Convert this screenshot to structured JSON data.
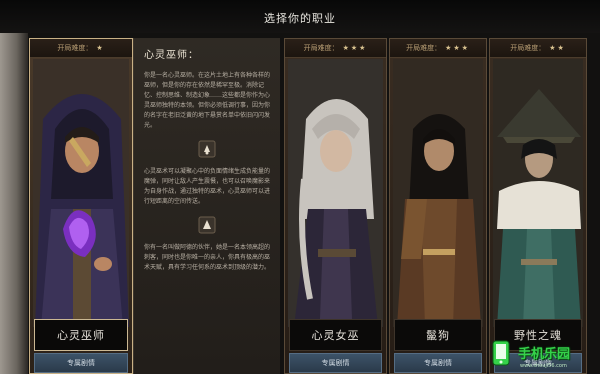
{
  "screen_title": "选择你的职业",
  "cards": [
    {
      "difficulty_label": "开局难度：",
      "stars": "★",
      "name": "心灵巫师",
      "story_button": "专属剧情"
    },
    {
      "difficulty_label": "开局难度：",
      "stars": "★★★",
      "name": "心灵女巫",
      "story_button": "专属剧情"
    },
    {
      "difficulty_label": "开局难度：",
      "stars": "★★★",
      "name": "鬣狗",
      "story_button": "专属剧情"
    },
    {
      "difficulty_label": "开局难度：",
      "stars": "★★",
      "name": "野性之魂",
      "story_button": "专属剧情"
    }
  ],
  "detail": {
    "title": "心灵巫师：",
    "paragraph1": "你是一名心灵巫师。在这片土地上有各种各样的巫师，但是你的存在依然是稀罕至极。消除记忆、控制思维、制造幻象……这些都是你作为心灵巫师独特的本领。但你必须低调行事，因为你的名字在老旧泛黄的地下悬赏名单中依旧闪闪发光。",
    "paragraph2": "心灵巫术可以凝聚心中的负面情绪生成负能量的魔弹，同时让敌人产生震慑，也可以召唤魔影来为自身作战，通过独特的巫术，心灵巫师可以进行短距离的空间传送。",
    "paragraph3": "你有一名叫做阿德的伙伴，她是一名本领高超的刺客，同时也是你唯一的亲人，你具有极高的巫术天赋，具有学习任何系的巫术到顶级的潜力。"
  },
  "watermark": {
    "text": "手机乐园",
    "sub": "www.shouji56.com"
  },
  "colors": {
    "accent": "#c9b186",
    "story_button": "#3d5368",
    "logo_green": "#35d24a"
  }
}
